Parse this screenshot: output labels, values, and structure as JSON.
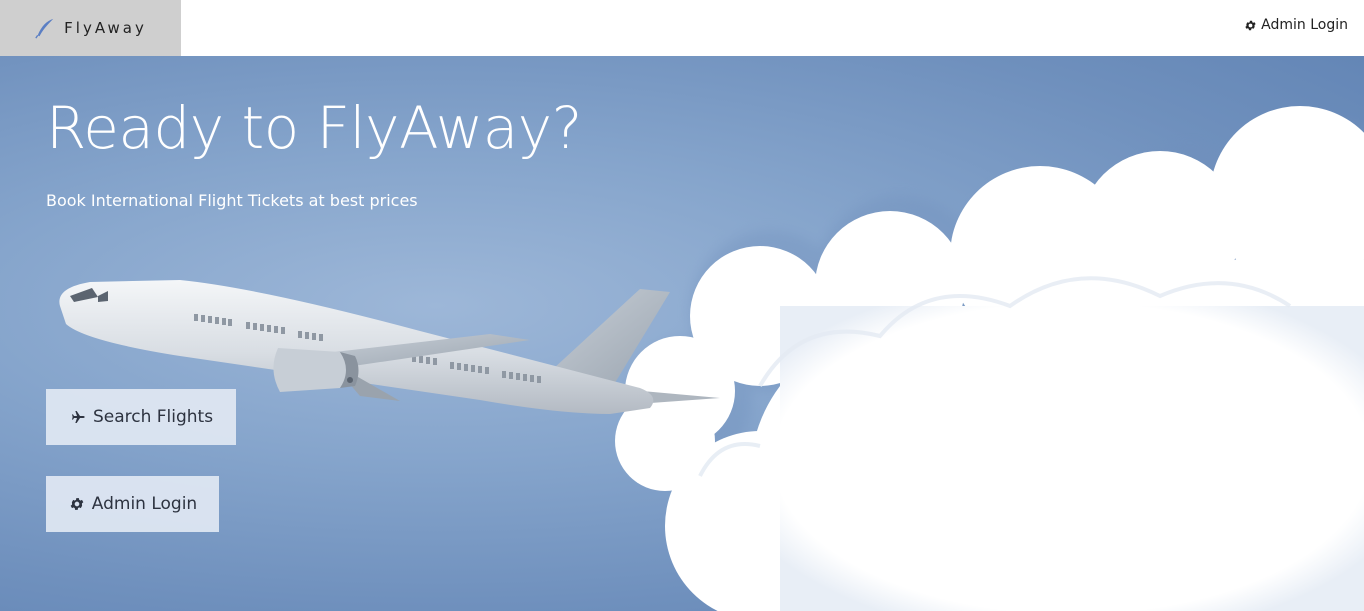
{
  "brand": {
    "name": "FlyAway",
    "icon": "feather-icon"
  },
  "nav": {
    "admin_login": "Admin Login",
    "admin_icon": "gear-icon"
  },
  "hero": {
    "headline": "Ready to FlyAway?",
    "subheading": "Book International Flight Tickets at best prices",
    "search_button": "Search Flights",
    "search_icon": "plane-icon",
    "admin_button": "Admin Login",
    "admin_icon": "gear-icon"
  },
  "colors": {
    "sky": "#86a5cc",
    "brand_bg": "#cfcfcf",
    "button_bg": "#e1e8f3",
    "text_dark": "#2d3340"
  }
}
